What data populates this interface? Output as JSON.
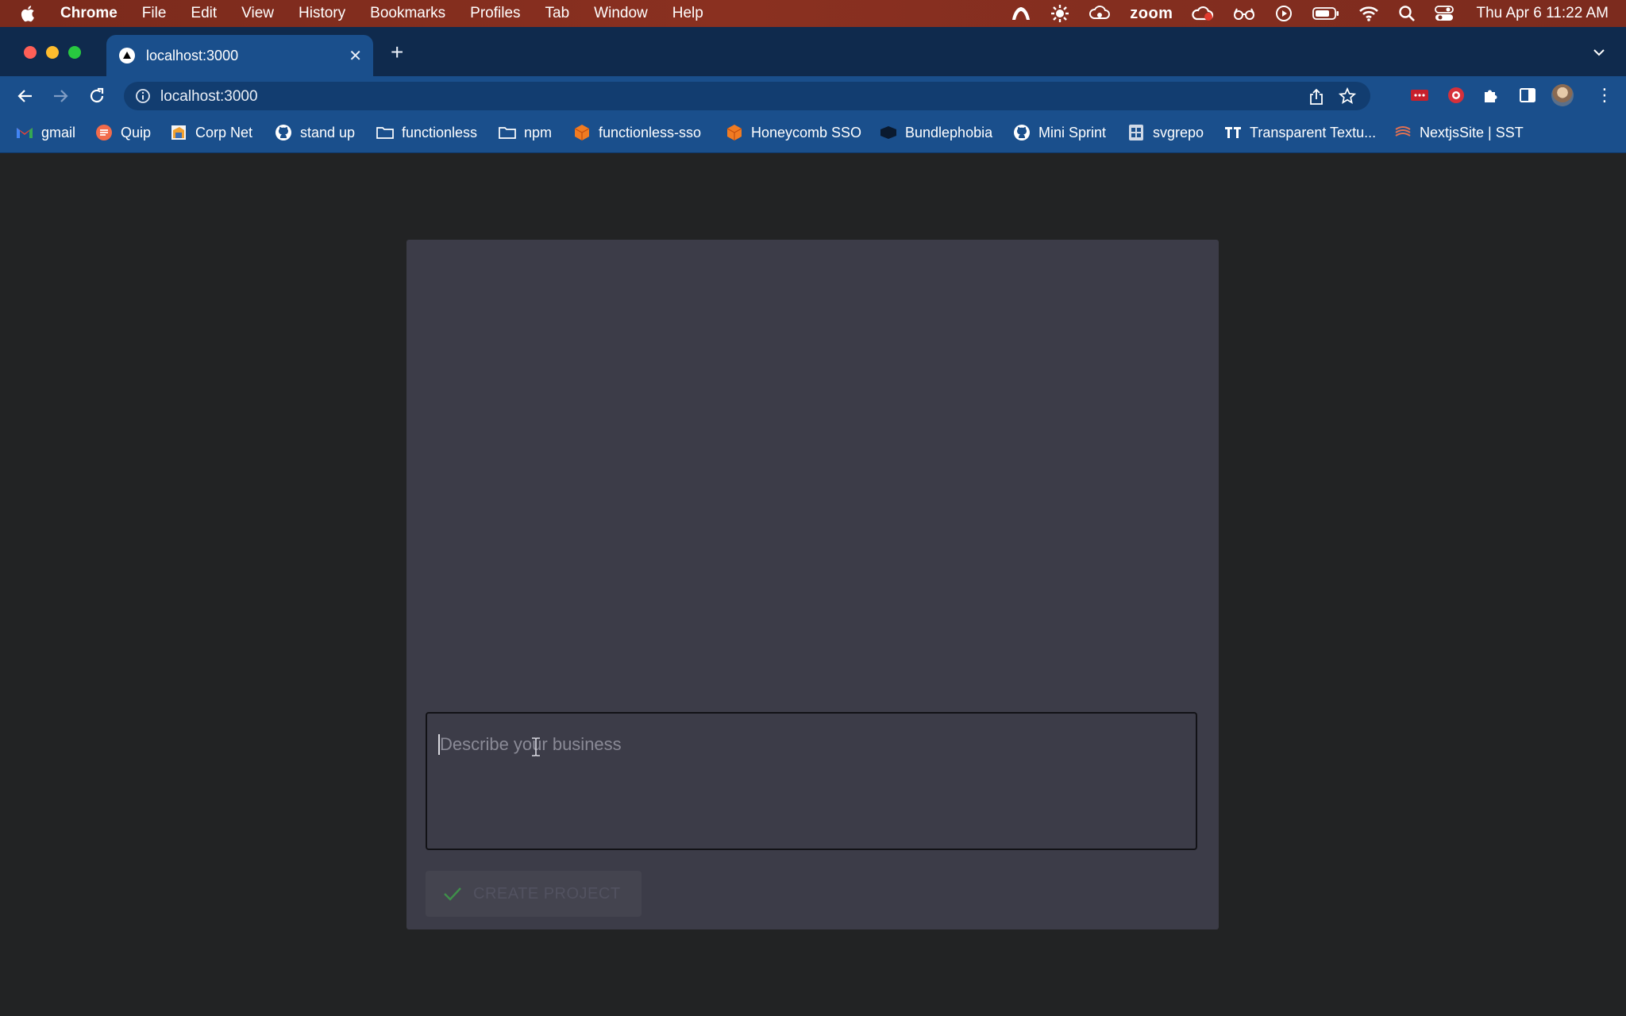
{
  "menubar": {
    "app_name": "Chrome",
    "items": [
      "File",
      "Edit",
      "View",
      "History",
      "Bookmarks",
      "Profiles",
      "Tab",
      "Window",
      "Help"
    ],
    "zoom_label": "zoom",
    "clock": "Thu Apr 6  11:22 AM"
  },
  "browser": {
    "tab_title": "localhost:3000",
    "url": "localhost:3000",
    "colors": {
      "frame": "#0f2a4d",
      "toolbar": "#1a4f8c",
      "omnibox": "#123d70"
    }
  },
  "bookmarks": [
    {
      "label": "gmail",
      "icon": "gmail-icon"
    },
    {
      "label": "Quip",
      "icon": "quip-icon"
    },
    {
      "label": "Corp Net",
      "icon": "corp-net-icon"
    },
    {
      "label": "stand up",
      "icon": "github-icon"
    },
    {
      "label": "functionless",
      "icon": "folder-icon"
    },
    {
      "label": "npm",
      "icon": "folder-icon"
    },
    {
      "label": "functionless-sso",
      "icon": "box-icon"
    },
    {
      "label": "Honeycomb SSO",
      "icon": "box-icon"
    },
    {
      "label": "Bundlephobia",
      "icon": "bundlephobia-icon"
    },
    {
      "label": "Mini Sprint",
      "icon": "github-icon"
    },
    {
      "label": "svgrepo",
      "icon": "svgrepo-icon"
    },
    {
      "label": "Transparent Textu...",
      "icon": "tt-icon"
    },
    {
      "label": "NextjsSite | SST",
      "icon": "sst-icon"
    }
  ],
  "form": {
    "description_placeholder": "Describe your business",
    "description_value": "",
    "create_button_label": "CREATE PROJECT",
    "colors": {
      "card": "#3c3c48",
      "page": "#222324",
      "check": "#3f8f4a"
    }
  }
}
